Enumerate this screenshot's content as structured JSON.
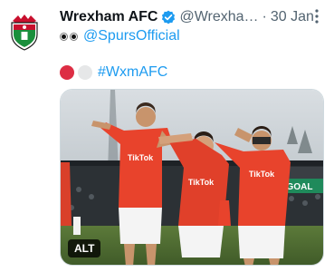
{
  "tweet": {
    "display_name": "Wrexham AFC",
    "handle": "@Wrexha…",
    "separator": "·",
    "time": "30 Jan",
    "reply_to": "@SpursOfficial",
    "hashtag": "#WxmAFC",
    "avatar_icon": "wrexham-crest-icon",
    "verified_color": "#1d9bf0",
    "link_color": "#1d9bf0"
  },
  "media": {
    "alt_label": "ALT",
    "shirt_sponsor": "TikTok",
    "board_text": "GOAL",
    "board_color": "#1f8a5b",
    "kit_color": "#e8432c"
  }
}
